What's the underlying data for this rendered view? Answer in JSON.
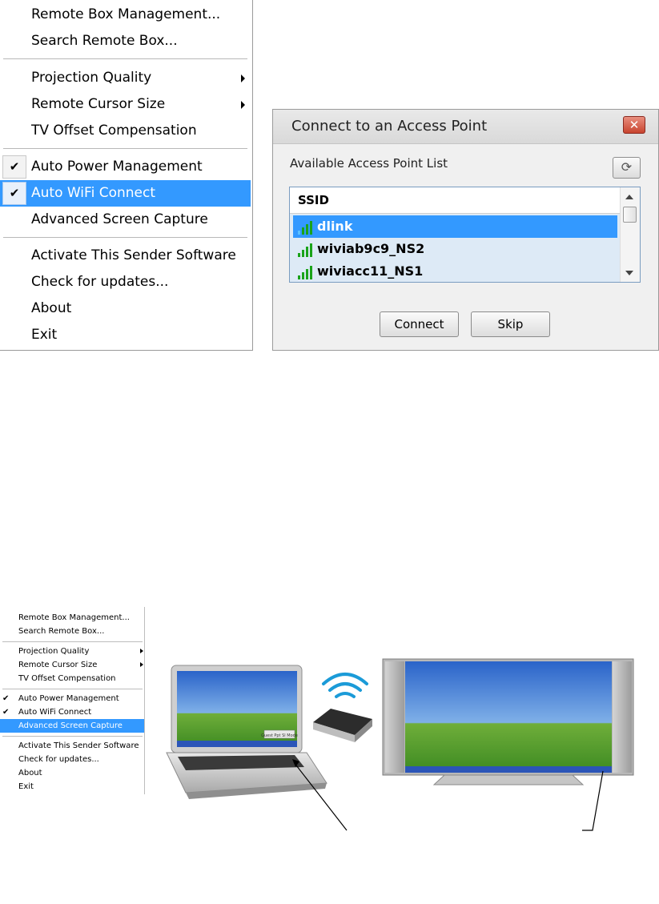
{
  "big_menu": {
    "items": [
      {
        "label": "Remote Box Management..."
      },
      {
        "label": "Search Remote Box..."
      },
      {
        "label": "Projection Quality"
      },
      {
        "label": "Remote Cursor Size"
      },
      {
        "label": "TV Offset Compensation"
      },
      {
        "label": "Auto Power Management"
      },
      {
        "label": "Auto WiFi Connect"
      },
      {
        "label": "Advanced Screen Capture"
      },
      {
        "label": "Activate This Sender Software"
      },
      {
        "label": "Check for updates..."
      },
      {
        "label": "About"
      },
      {
        "label": "Exit"
      }
    ],
    "highlighted": "Auto WiFi Connect",
    "checked": [
      "Auto Power Management",
      "Auto WiFi Connect"
    ],
    "check_glyph": "✔"
  },
  "dialog": {
    "title": "Connect to an Access Point",
    "close_glyph": "✕",
    "list_label": "Available Access Point List",
    "refresh_glyph": "⟳",
    "column_header": "SSID",
    "access_points": [
      {
        "ssid": "dlink",
        "selected": true
      },
      {
        "ssid": "wiviab9c9_NS2",
        "selected": false
      },
      {
        "ssid": "wiviacc11_NS1",
        "selected": false
      }
    ],
    "connect_label": "Connect",
    "skip_label": "Skip"
  },
  "small_menu": {
    "items": [
      {
        "label": "Remote Box Management..."
      },
      {
        "label": "Search Remote Box..."
      },
      {
        "label": "Projection Quality"
      },
      {
        "label": "Remote Cursor Size"
      },
      {
        "label": "TV Offset Compensation"
      },
      {
        "label": "Auto Power Management"
      },
      {
        "label": "Auto WiFi Connect"
      },
      {
        "label": "Advanced Screen Capture"
      },
      {
        "label": "Activate This Sender Software"
      },
      {
        "label": "Check for updates..."
      },
      {
        "label": "About"
      },
      {
        "label": "Exit"
      }
    ],
    "highlighted": "Advanced Screen Capture",
    "checked": [
      "Auto Power Management",
      "Auto WiFi Connect"
    ],
    "check_glyph": "✔"
  },
  "illustration": {
    "screen_caption": "Guest Ppt Sl Mode",
    "icons": [
      "laptop-icon",
      "wifi-signal-icon",
      "receiver-box-icon",
      "tv-monitor-icon"
    ]
  },
  "colors": {
    "highlight": "#3399ff",
    "list_background": "#ddeaf6",
    "signal_green": "#1aa31a"
  }
}
